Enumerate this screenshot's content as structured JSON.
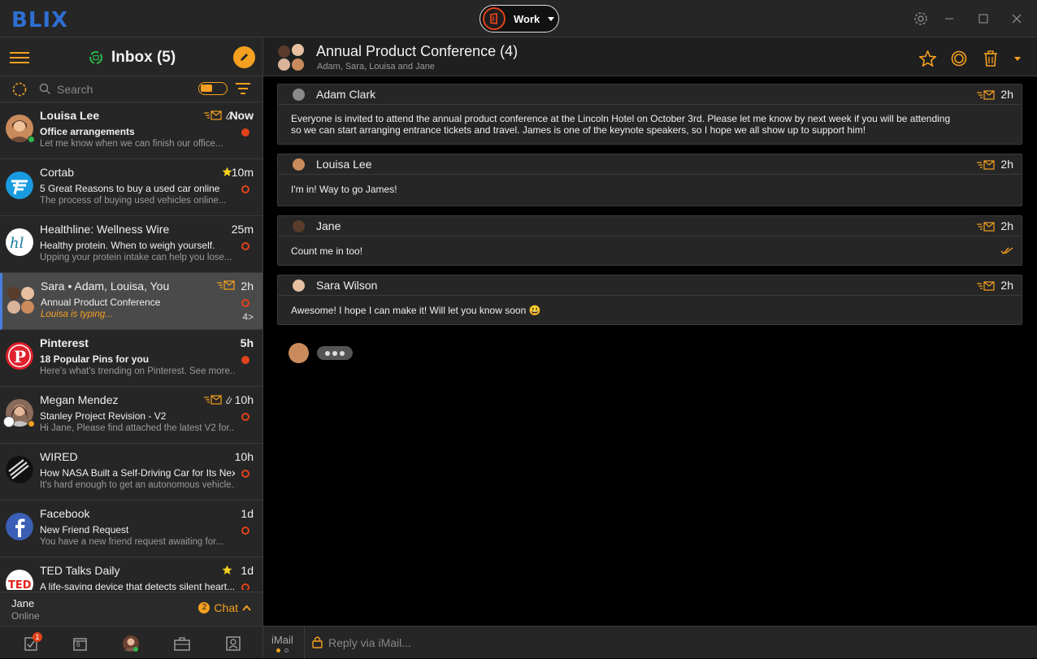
{
  "app": {
    "logo": "BLIX",
    "account_label": "Work"
  },
  "sidebar": {
    "inbox_title": "Inbox (5)",
    "search_placeholder": "Search",
    "mails": [
      {
        "sender": "Louisa Lee",
        "subject": "Office arrangements",
        "preview": "Let me know when we can finish our office...",
        "time": "Now",
        "unread": true,
        "icons": [
          "forward-mail-icon",
          "attachment-icon"
        ]
      },
      {
        "sender": "Cortab",
        "subject": "5 Great Reasons to buy a used car online",
        "preview": "The process of buying used vehicles online...",
        "time": "10m",
        "unread": false,
        "icons": [
          "star-icon"
        ]
      },
      {
        "sender": "Healthline: Wellness Wire",
        "subject": "Healthy protein. When to weigh yourself.",
        "preview": "Upping your protein intake can help you lose...",
        "time": "25m",
        "unread": false,
        "icons": []
      },
      {
        "sender": "Sara • Adam, Louisa, You",
        "subject": "Annual Product Conference",
        "preview": "Louisa is typing...",
        "time": "2h",
        "count": "4>",
        "unread": false,
        "icons": [
          "forward-mail-icon"
        ]
      },
      {
        "sender": "Pinterest",
        "subject": "18 Popular Pins for you",
        "preview": "Here's what's trending on Pinterest. See more...",
        "time": "5h",
        "unread": true,
        "icons": []
      },
      {
        "sender": "Megan Mendez",
        "subject": "Stanley Project Revision - V2",
        "preview": "Hi Jane, Please find attached the latest V2 for...",
        "time": "10h",
        "unread": false,
        "icons": [
          "forward-mail-icon",
          "attachment-icon"
        ]
      },
      {
        "sender": "WIRED",
        "subject": "How NASA Built a Self-Driving Car for Its Next...",
        "preview": "It's hard enough to get an autonomous vehicle...",
        "time": "10h",
        "unread": false,
        "icons": []
      },
      {
        "sender": "Facebook",
        "subject": "New Friend Request",
        "preview": "You have a new friend request awaiting for...",
        "time": "1d",
        "unread": false,
        "icons": []
      },
      {
        "sender": "TED Talks Daily",
        "subject": "A life-saving device that detects silent heart...",
        "preview": "",
        "time": "1d",
        "unread": false,
        "icons": [
          "star-icon"
        ]
      }
    ],
    "chat": {
      "user_name": "Jane",
      "user_status": "Online",
      "badge_count": "2",
      "label": "Chat"
    },
    "nav_badge": "1",
    "calendar_day": "6"
  },
  "conversation": {
    "title": "Annual Product Conference (4)",
    "participants": "Adam, Sara, Louisa and Jane",
    "messages": [
      {
        "sender": "Adam Clark",
        "time": "2h",
        "body": "Everyone is invited to attend the annual product conference at the Lincoln Hotel on October 3rd. Please let me know by next week if you will be attending so we can start arranging entrance tickets and travel. James is one of the keynote speakers, so I hope we all show up to support him!"
      },
      {
        "sender": "Louisa Lee",
        "time": "2h",
        "body": "I'm in! Way to go James!"
      },
      {
        "sender": "Jane",
        "time": "2h",
        "body": "Count me in too!"
      },
      {
        "sender": "Sara Wilson",
        "time": "2h",
        "body": "Awesome! I hope I can make it! Will let you know soon 😃"
      }
    ]
  },
  "reply": {
    "channel": "iMail",
    "placeholder": "Reply via iMail..."
  },
  "colors": {
    "accent": "#f5a020",
    "unread": "#e2421c",
    "brand": "#2e6fd1",
    "selected_border": "#4a7fe0"
  }
}
